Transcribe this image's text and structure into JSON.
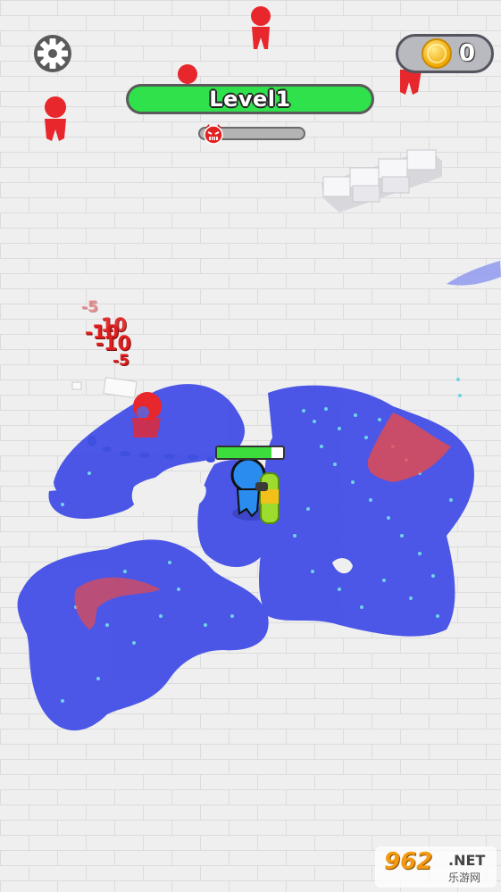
{
  "hud": {
    "level_label": "Level1",
    "coin_count": "0",
    "boss_progress": 0.05,
    "player_health": 0.82
  },
  "damage_popups": [
    "-5",
    "-10",
    "-10",
    "-10",
    "-5"
  ],
  "watermark": {
    "logo_text": "962",
    "net_text": ".NET",
    "cn_text": "乐游网"
  },
  "colors": {
    "player_paint": "#4550e6",
    "enemy_paint": "#e84a4a",
    "enemy": "#e8272c",
    "player": "#2b8cf0",
    "level_bar_fill": "#2fe24b",
    "coin": "#f7c21a"
  }
}
